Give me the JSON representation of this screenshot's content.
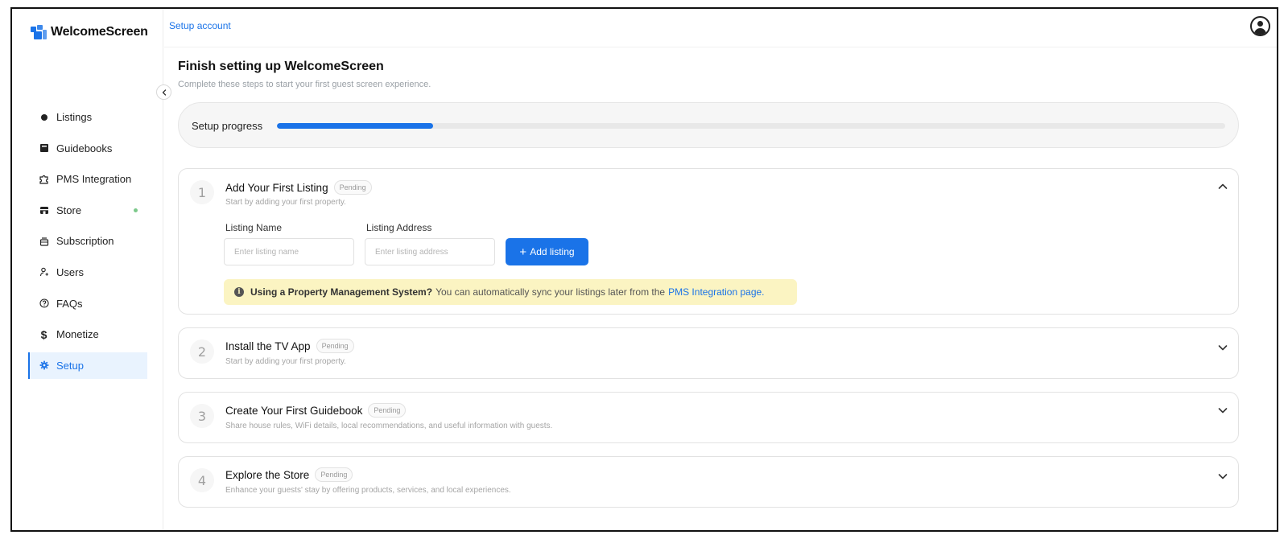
{
  "app": {
    "brand": "WelcomeScreen",
    "brand_color": "#1a73e8"
  },
  "sidebar": {
    "items": [
      {
        "label": "Listings",
        "icon": "dot-icon",
        "active": false
      },
      {
        "label": "Guidebooks",
        "icon": "book-icon",
        "active": false
      },
      {
        "label": "PMS Integration",
        "icon": "puzzle-icon",
        "active": false
      },
      {
        "label": "Store",
        "icon": "store-icon",
        "active": false,
        "indicator": "green-dot"
      },
      {
        "label": "Subscription",
        "icon": "subscription-icon",
        "active": false
      },
      {
        "label": "Users",
        "icon": "users-icon",
        "active": false
      },
      {
        "label": "FAQs",
        "icon": "help-icon",
        "active": false
      },
      {
        "label": "Monetize",
        "icon": "dollar-icon",
        "active": false
      },
      {
        "label": "Setup",
        "icon": "gear-icon",
        "active": true
      }
    ]
  },
  "header": {
    "breadcrumb": "Setup account",
    "avatar_icon": "user-avatar-icon"
  },
  "main": {
    "title": "Finish setting up WelcomeScreen",
    "subtitle": "Complete these steps to start your first guest screen experience.",
    "progress": {
      "label": "Setup progress",
      "value_percent": 16.5
    },
    "steps": [
      {
        "number": "1",
        "title": "Add Your First Listing",
        "status": "Pending",
        "description": "Start by adding your first property.",
        "expanded": true,
        "form": {
          "name_label": "Listing Name",
          "name_placeholder": "Enter listing name",
          "address_label": "Listing Address",
          "address_placeholder": "Enter listing address",
          "add_button": "Add listing"
        },
        "notice": {
          "bold": "Using a Property Management System?",
          "text": "You can automatically sync your listings later from the",
          "link": "PMS Integration page."
        }
      },
      {
        "number": "2",
        "title": "Install the TV App",
        "status": "Pending",
        "description": "Start by adding your first property.",
        "expanded": false
      },
      {
        "number": "3",
        "title": "Create Your First Guidebook",
        "status": "Pending",
        "description": "Share house rules, WiFi details, local recommendations, and useful information with guests.",
        "expanded": false
      },
      {
        "number": "4",
        "title": "Explore the Store",
        "status": "Pending",
        "description": "Enhance your guests' stay by offering products, services, and local experiences.",
        "expanded": false
      }
    ]
  }
}
